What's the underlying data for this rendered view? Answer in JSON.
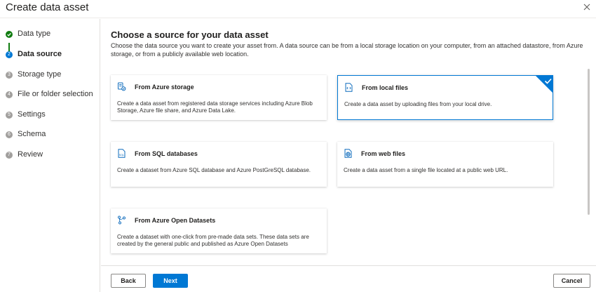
{
  "window": {
    "title": "Create data asset",
    "close_icon": "close-icon"
  },
  "steps": [
    {
      "label": "Data type",
      "status": "done"
    },
    {
      "label": "Data source",
      "status": "current",
      "number": "2"
    },
    {
      "label": "Storage type",
      "status": "pending",
      "number": "3"
    },
    {
      "label": "File or folder selection",
      "status": "pending",
      "number": "4"
    },
    {
      "label": "Settings",
      "status": "pending",
      "number": "5"
    },
    {
      "label": "Schema",
      "status": "pending",
      "number": "6"
    },
    {
      "label": "Review",
      "status": "pending",
      "number": "7"
    }
  ],
  "main": {
    "heading": "Choose a source for your data asset",
    "description": "Choose the data source you want to create your asset from. A data source can be from a local storage location on your computer, from an attached datastore, from Azure storage, or from a publicly available web location."
  },
  "cards": [
    {
      "title": "From Azure storage",
      "description": "Create a data asset from registered data storage services including Azure Blob Storage, Azure file share, and Azure Data Lake.",
      "icon": "azure-storage-icon",
      "selected": false
    },
    {
      "title": "From local files",
      "description": "Create a data asset by uploading files from your local drive.",
      "icon": "local-file-icon",
      "selected": true
    },
    {
      "title": "From SQL databases",
      "description": "Create a dataset from Azure SQL database and Azure PostGreSQL database.",
      "icon": "sql-database-icon",
      "selected": false
    },
    {
      "title": "From web files",
      "description": "Create a data asset from a single file located at a public web URL.",
      "icon": "web-file-icon",
      "selected": false
    },
    {
      "title": "From Azure Open Datasets",
      "description": "Create a dataset with one-click from pre-made data sets. These data sets are created by the general public and published as Azure Open Datasets",
      "icon": "open-datasets-icon",
      "selected": false
    }
  ],
  "footer": {
    "back_label": "Back",
    "next_label": "Next",
    "cancel_label": "Cancel"
  },
  "colors": {
    "accent": "#0078d4",
    "success": "#107c10",
    "pending": "#a19f9d"
  }
}
